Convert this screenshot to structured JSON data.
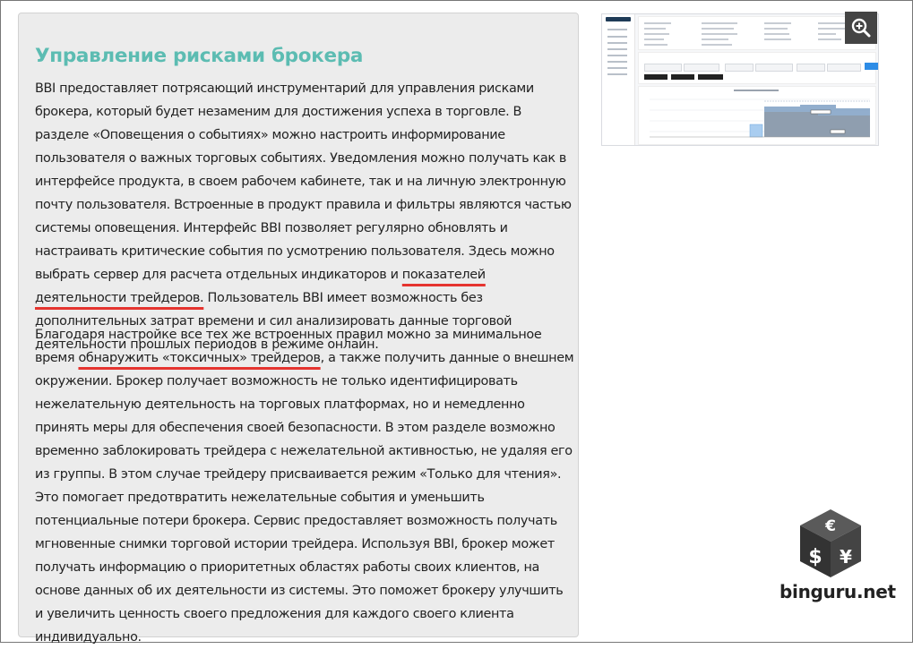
{
  "article": {
    "title": "Управление рисками брокера",
    "p1": {
      "before": "BBI предоставляет потрясающий инструментарий для управления рисками брокера, который будет незаменим для достижения успеха в торговле. В разделе «Оповещения о событиях» можно настроить информирование пользователя о важных торговых событиях. Уведомления можно получать как в интерфейсе продукта, в своем рабочем кабинете, так и на личную электронную почту пользователя. Встроенные в продукт правила и фильтры являются частью системы оповещения. Интерфейс BBI позволяет регулярно обновлять и настраивать критические события по усмотрению пользователя. Здесь можно выбрать сервер для расчета отдельных индикаторов и ",
      "highlight": "показателей деятельности трейдеров.",
      "after": " Пользователь BBI имеет возможность без дополнительных затрат времени и сил анализировать данные торговой деятельности прошлых периодов в режиме онлайн."
    },
    "p2": {
      "before": "Благодаря настройке все тех же встроенных правил можно за минимальное время ",
      "highlight": "обнаружить «токсичных» трейдеров",
      "after": ", а также получить данные о внешнем окружении. Брокер получает возможность не только идентифицировать нежелательную деятельность на торговых платформах, но и немедленно принять меры для обеспечения своей безопасности. В этом разделе возможно временно заблокировать трейдера с нежелательной активностью, не удаляя его из группы. В этом случае трейдеру присваивается режим «Только для чтения». Это помогает предотвратить нежелательные события и уменьшить потенциальные потери брокера. Сервис предоставляет возможность получать мгновенные снимки торговой истории трейдера. Используя BBI, брокер может получать информацию о приоритетных областях работы своих клиентов, на основе данных об их деятельности из системы. Это поможет брокеру улучшить и увеличить ценность своего предложения для каждого своего клиента индивидуально."
    }
  },
  "thumbnail": {
    "chart_title": "Account deposit and PnL history"
  },
  "zoom": {
    "icon": "zoom-in-icon"
  },
  "logo": {
    "icon": "currency-cube-icon",
    "text": "binguru.net"
  },
  "colors": {
    "title": "#5cbcb2",
    "underline": "#e5342f",
    "panel": "#ececec"
  }
}
